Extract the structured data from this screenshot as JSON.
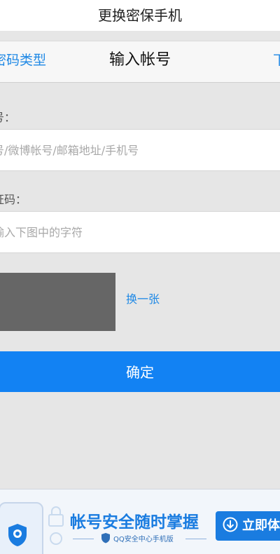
{
  "top_title": "更换密保手机",
  "navbar": {
    "back_label": "密码类型",
    "title": "输入帐号",
    "next_label": "下"
  },
  "account": {
    "label": "号：",
    "placeholder": "号/微博帐号/邮箱地址/手机号"
  },
  "captcha": {
    "label": "证码：",
    "placeholder": "输入下图中的字符",
    "refresh_label": "换一张"
  },
  "confirm_label": "确定",
  "banner": {
    "headline": "帐号安全随时掌握",
    "subline": "QQ安全中心手机版",
    "download_label": "立即体验",
    "accent": "#1a7ce0"
  },
  "colors": {
    "primary_button": "#1282f3",
    "link": "#1e88e5",
    "page_bg": "#e6e6e6"
  }
}
